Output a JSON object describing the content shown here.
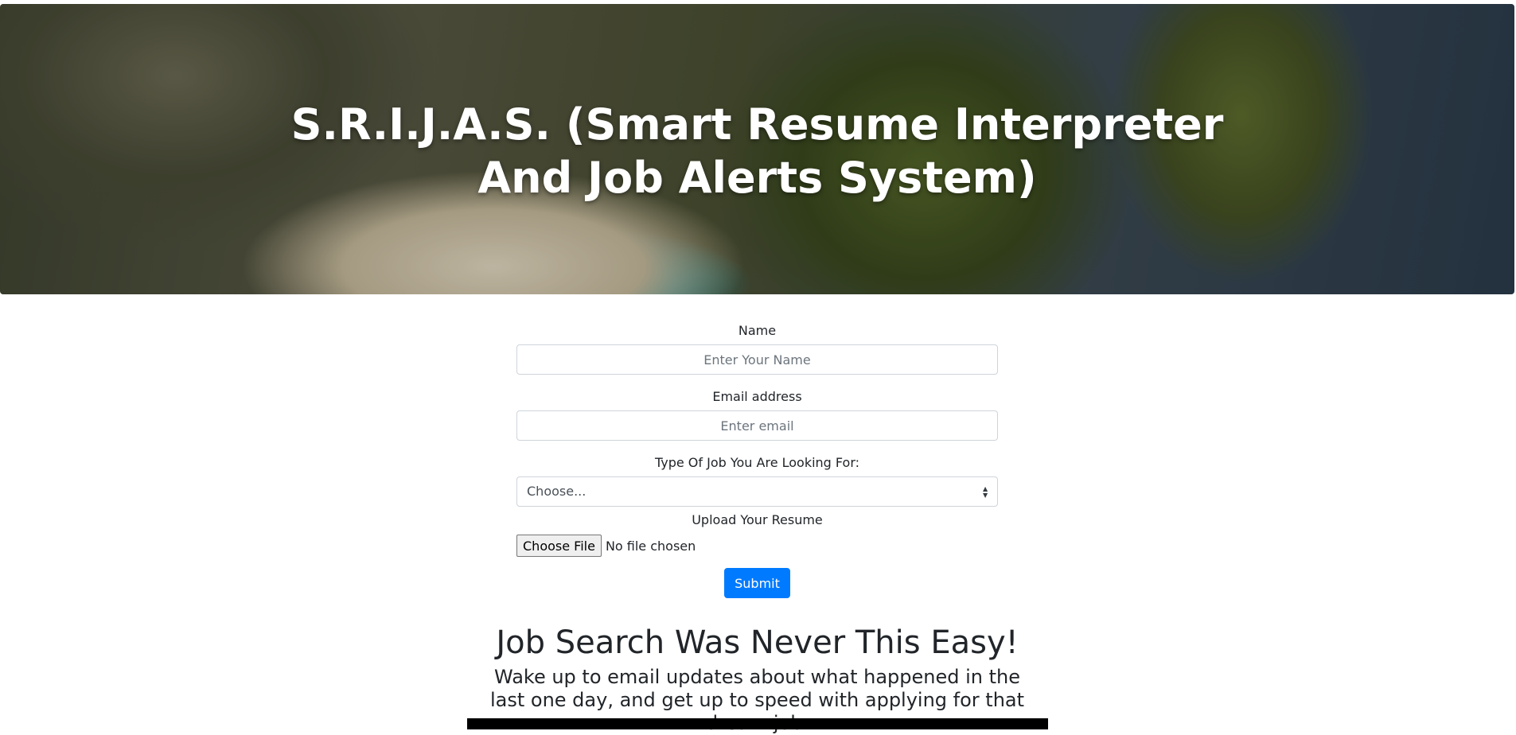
{
  "hero": {
    "title_line1": "S.R.I.J.A.S. (Smart Resume Interpreter",
    "title_line2": "And Job Alerts System)"
  },
  "form": {
    "name_label": "Name",
    "name_placeholder": "Enter Your Name",
    "email_label": "Email address",
    "email_placeholder": "Enter email",
    "job_type_label": "Type Of Job You Are Looking For:",
    "job_type_selected": "Choose...",
    "resume_label": "Upload Your Resume",
    "file_button_label": "Choose File",
    "file_status": "No file chosen",
    "submit_label": "Submit"
  },
  "promo": {
    "heading": "Job Search Was Never This Easy!",
    "subtitle": "Wake up to email updates about what happened in the last one day, and get up to speed with applying for that dream job."
  },
  "colors": {
    "primary": "#007bff",
    "text": "#212529",
    "border": "#ced4da"
  },
  "icons": {
    "select_arrow": "sort-arrows-icon"
  }
}
